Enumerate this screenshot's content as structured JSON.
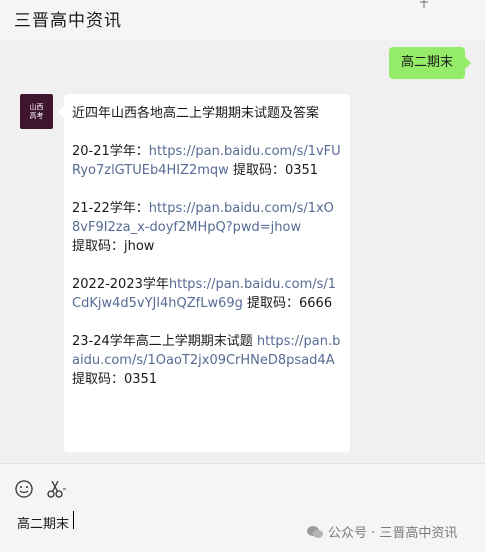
{
  "header": {
    "title": "三晋高中资讯"
  },
  "chat": {
    "my_message": "高二期末",
    "avatar_text": [
      "山西",
      "高考"
    ],
    "reply": {
      "intro": "近四年山西各地高二上学期期末试题及答案",
      "items": [
        {
          "prefix": "20-21学年：",
          "link": "https://pan.baidu.com/s/1vFURyo7zlGTUEb4HIZ2mqw",
          "suffix": " 提取码：0351"
        },
        {
          "prefix": "21-22学年：",
          "link": "https://pan.baidu.com/s/1xO8vF9I2za_x-doyf2MHpQ?pwd=jhow",
          "suffix": "\n提取码：jhow"
        },
        {
          "prefix": "2022-2023学年",
          "link": "https://pan.baidu.com/s/1CdKjw4d5vYJl4hQZfLw69g",
          "suffix": " 提取码：6666"
        },
        {
          "prefix": "23-24学年高二上学期期末试题 ",
          "link": "https://pan.baidu.com/s/1OaoT2jx09CrHNeD8psad4A",
          "suffix": " 提取码：0351"
        }
      ]
    }
  },
  "input": {
    "text": "高二期末"
  },
  "watermark": {
    "text": "公众号 · 三晋高中资讯"
  },
  "colors": {
    "my_bubble": "#95ec69",
    "link": "#576b95",
    "avatar_bg": "#40152f"
  }
}
